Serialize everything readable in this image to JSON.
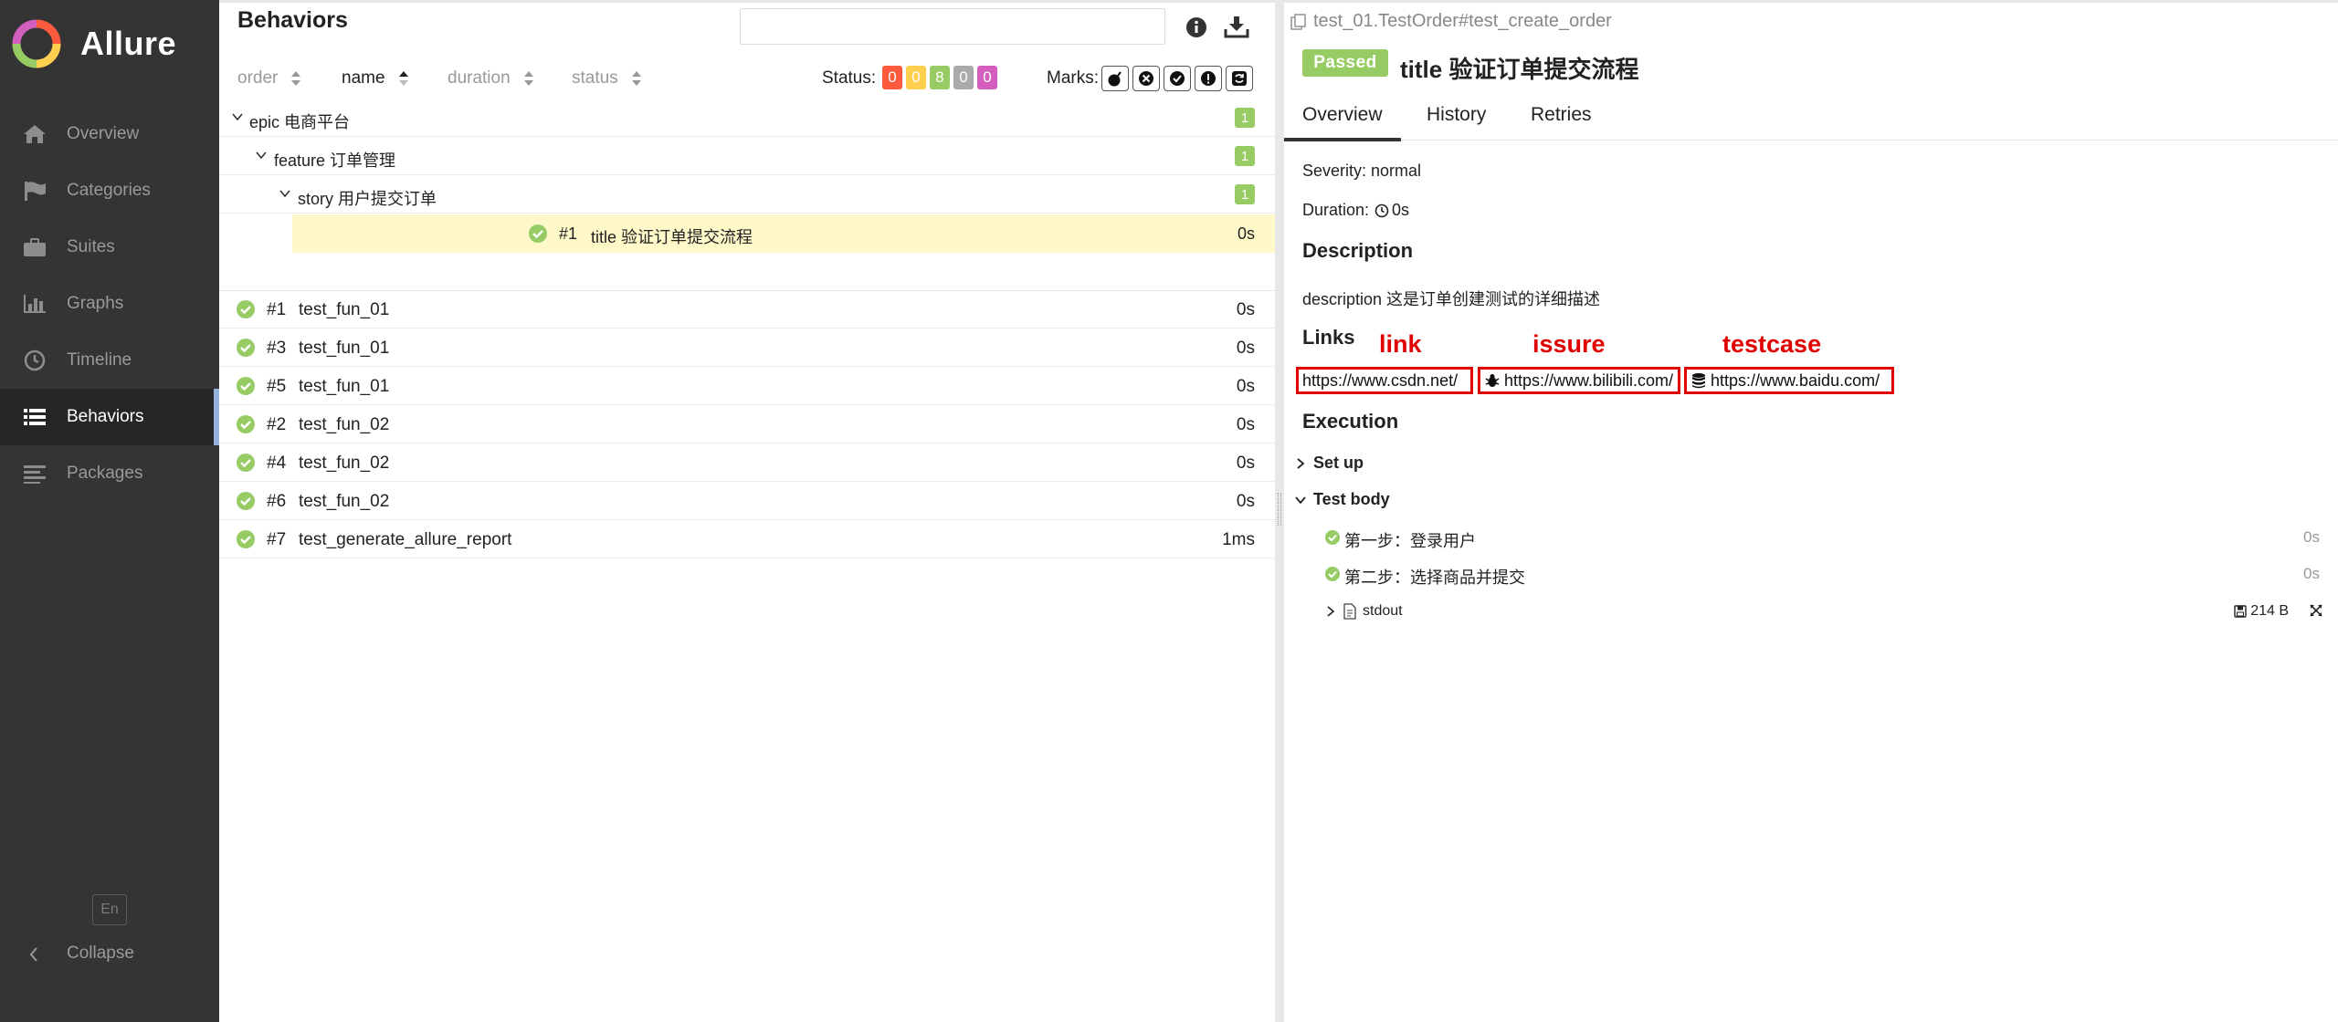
{
  "app": {
    "brand": "Allure"
  },
  "sidebar": {
    "items": [
      {
        "label": "Overview",
        "icon": "home-icon"
      },
      {
        "label": "Categories",
        "icon": "flag-icon"
      },
      {
        "label": "Suites",
        "icon": "briefcase-icon"
      },
      {
        "label": "Graphs",
        "icon": "bar-chart-icon"
      },
      {
        "label": "Timeline",
        "icon": "clock-icon"
      },
      {
        "label": "Behaviors",
        "icon": "list-icon",
        "active": true
      },
      {
        "label": "Packages",
        "icon": "align-left-icon"
      }
    ],
    "language": "En",
    "collapse_label": "Collapse"
  },
  "behaviors": {
    "title": "Behaviors",
    "search": {
      "value": "",
      "placeholder": ""
    },
    "sort": {
      "order": "order",
      "name": "name",
      "duration": "duration",
      "status": "status"
    },
    "status_label": "Status:",
    "status_counts": {
      "failed": "0",
      "broken": "0",
      "passed": "8",
      "skipped": "0",
      "unknown": "0"
    },
    "marks_label": "Marks:",
    "tree": {
      "epic": {
        "label": "epic 电商平台",
        "count": "1"
      },
      "feature": {
        "label": "feature 订单管理",
        "count": "1"
      },
      "story": {
        "label": "story 用户提交订单",
        "count": "1"
      },
      "leaf": {
        "num": "#1",
        "name": "title 验证订单提交流程",
        "duration": "0s"
      }
    },
    "tests": [
      {
        "num": "#1",
        "name": "test_fun_01",
        "duration": "0s"
      },
      {
        "num": "#3",
        "name": "test_fun_01",
        "duration": "0s"
      },
      {
        "num": "#5",
        "name": "test_fun_01",
        "duration": "0s"
      },
      {
        "num": "#2",
        "name": "test_fun_02",
        "duration": "0s"
      },
      {
        "num": "#4",
        "name": "test_fun_02",
        "duration": "0s"
      },
      {
        "num": "#6",
        "name": "test_fun_02",
        "duration": "0s"
      },
      {
        "num": "#7",
        "name": "test_generate_allure_report",
        "duration": "1ms"
      }
    ]
  },
  "detail": {
    "path": "test_01.TestOrder#test_create_order",
    "status": "Passed",
    "title": "title 验证订单提交流程",
    "tabs": [
      "Overview",
      "History",
      "Retries"
    ],
    "severity": "Severity: normal",
    "duration_label": "Duration:",
    "duration_value": "0s",
    "description_heading": "Description",
    "description": "description 这是订单创建测试的详细描述",
    "links_heading": "Links",
    "annotations": {
      "link": "link",
      "issue": "issure",
      "testcase": "testcase"
    },
    "links": {
      "link": "https://www.csdn.net/",
      "issue": "https://www.bilibili.com/",
      "testcase": "https://www.baidu.com/"
    },
    "execution_heading": "Execution",
    "setup_label": "Set up",
    "body_label": "Test body",
    "steps": [
      {
        "label": "第一步：登录用户",
        "duration": "0s"
      },
      {
        "label": "第二步：选择商品并提交",
        "duration": "0s"
      }
    ],
    "attachment": {
      "name": "stdout",
      "size": "214 B"
    }
  },
  "colors": {
    "sidebar_bg": "#343434",
    "passed": "#97cc64",
    "failed": "#fd5a3e",
    "broken": "#ffd050",
    "skipped": "#aaaaaa",
    "unknown": "#d35ebe",
    "annotation_red": "#e00000",
    "selected_row": "#fff8c8"
  }
}
